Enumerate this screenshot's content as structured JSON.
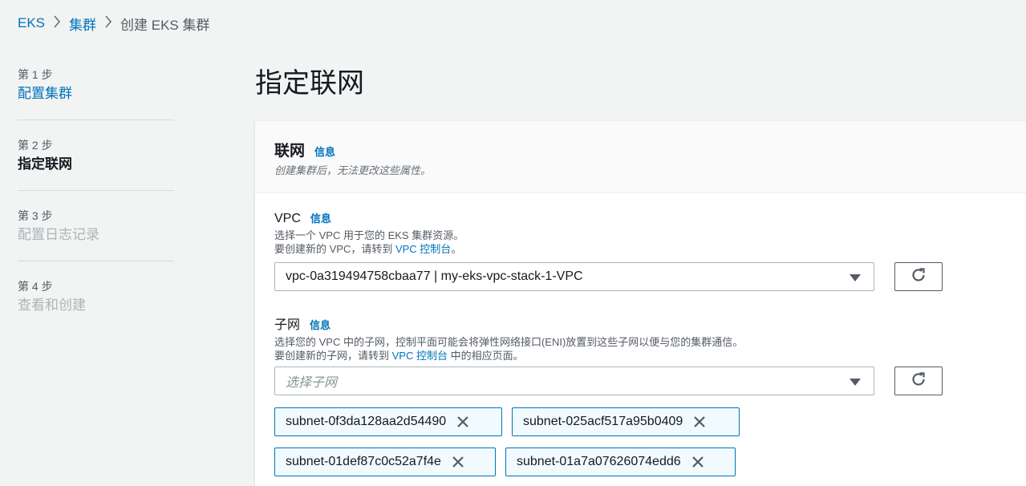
{
  "breadcrumb": {
    "items": [
      "EKS",
      "集群",
      "创建 EKS 集群"
    ]
  },
  "steps": [
    {
      "num": "第 1 步",
      "title": "配置集群",
      "state": "link"
    },
    {
      "num": "第 2 步",
      "title": "指定联网",
      "state": "active"
    },
    {
      "num": "第 3 步",
      "title": "配置日志记录",
      "state": "disabled"
    },
    {
      "num": "第 4 步",
      "title": "查看和创建",
      "state": "disabled"
    }
  ],
  "page": {
    "title": "指定联网"
  },
  "networking": {
    "title": "联网",
    "info": "信息",
    "description": "创建集群后，无法更改这些属性。"
  },
  "vpc": {
    "label": "VPC",
    "info": "信息",
    "desc_line1": "选择一个 VPC 用于您的 EKS 集群资源。",
    "desc_line2_prefix": "要创建新的 VPC，请转到 ",
    "desc_line2_link": "VPC 控制台",
    "desc_line2_suffix": "。",
    "selected": "vpc-0a319494758cbaa77 | my-eks-vpc-stack-1-VPC"
  },
  "subnets": {
    "label": "子网",
    "info": "信息",
    "desc_line1": "选择您的 VPC 中的子网，控制平面可能会将弹性网络接口(ENI)放置到这些子网以便与您的集群通信。",
    "desc_line2_prefix": "要创建新的子网，请转到 ",
    "desc_line2_link": "VPC 控制台",
    "desc_line2_suffix": " 中的相应页面。",
    "placeholder": "选择子网",
    "selected": [
      "subnet-0f3da128aa2d54490",
      "subnet-025acf517a95b0409",
      "subnet-01def87c0c52a7f4e",
      "subnet-01a7a07626074edd6"
    ]
  },
  "icons": {
    "refresh": "refresh-icon",
    "remove": "close-icon",
    "dropdown": "caret-down-icon",
    "separator": "chevron-right-icon"
  },
  "colors": {
    "link": "#0073bb",
    "token_border": "#0073bb",
    "token_bg": "#f1faff",
    "disabled": "#aab7b8",
    "background": "#f2f3f3"
  }
}
